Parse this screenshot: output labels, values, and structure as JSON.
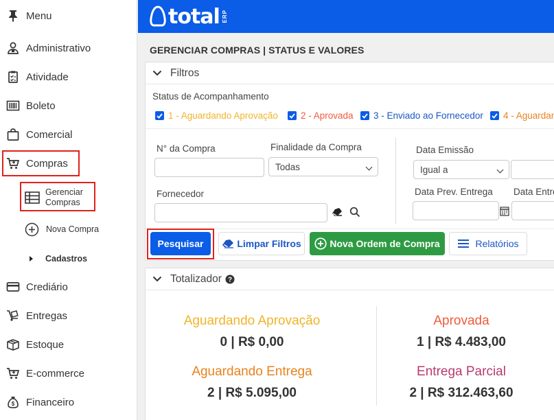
{
  "sidebar": {
    "menu_label": "Menu",
    "items": [
      {
        "label": "Administrativo",
        "icon": "user-icon"
      },
      {
        "label": "Atividade",
        "icon": "clipboard-icon"
      },
      {
        "label": "Boleto",
        "icon": "barcode-icon"
      },
      {
        "label": "Comercial",
        "icon": "bag-icon"
      },
      {
        "label": "Compras",
        "icon": "cart-icon"
      },
      {
        "label": "Crediário",
        "icon": "card-icon"
      },
      {
        "label": "Entregas",
        "icon": "delivery-icon"
      },
      {
        "label": "Estoque",
        "icon": "box-icon"
      },
      {
        "label": "E-commerce",
        "icon": "cart-icon"
      },
      {
        "label": "Financeiro",
        "icon": "money-bag-icon"
      }
    ],
    "compras_sub": {
      "gerenciar_line1": "Gerenciar",
      "gerenciar_line2": "Compras",
      "nova_compra": "Nova Compra",
      "cadastros": "Cadastros"
    }
  },
  "header": {
    "logo_text": "total",
    "logo_sub": "ERP",
    "brand_color": "#0b5ce6"
  },
  "page": {
    "title": "GERENCIAR COMPRAS | STATUS E VALORES"
  },
  "filters": {
    "heading": "Filtros",
    "status_label": "Status de Acompanhamento",
    "statuses": [
      {
        "label": "1 - Aguardando Aprovação",
        "color": "#f0b42a"
      },
      {
        "label": "2 - Aprovada",
        "color": "#ef5a3b"
      },
      {
        "label": "3 - Enviado ao Fornecedor",
        "color": "#1a56c4"
      },
      {
        "label": "4 - Aguardan",
        "color": "#e8821e"
      }
    ],
    "numero_label": "N° da Compra",
    "numero_value": "",
    "finalidade_label": "Finalidade da Compra",
    "finalidade_value": "Todas",
    "fornecedor_label": "Fornecedor",
    "fornecedor_value": "",
    "data_emissao_label": "Data Emissão",
    "data_emissao_op": "Igual a",
    "data_prev_label": "Data Prev. Entrega",
    "data_entrega_label": "Data Entre"
  },
  "buttons": {
    "pesquisar": "Pesquisar",
    "limpar": "Limpar Filtros",
    "nova_ordem": "Nova Ordem de Compra",
    "relatorios": "Relatórios"
  },
  "totalizador": {
    "heading": "Totalizador",
    "cards": [
      {
        "title": "Aguardando Aprovação",
        "value": "0 | R$ 0,00",
        "color": "#f0b42a"
      },
      {
        "title": "Aprovada",
        "value": "1 | R$ 4.483,00",
        "color": "#ef5a3b"
      },
      {
        "title": "Aguardando Entrega",
        "value": "2 | R$ 5.095,00",
        "color": "#e8821e"
      },
      {
        "title": "Entrega Parcial",
        "value": "2 | R$ 312.463,60",
        "color": "#b83a6e"
      }
    ]
  }
}
